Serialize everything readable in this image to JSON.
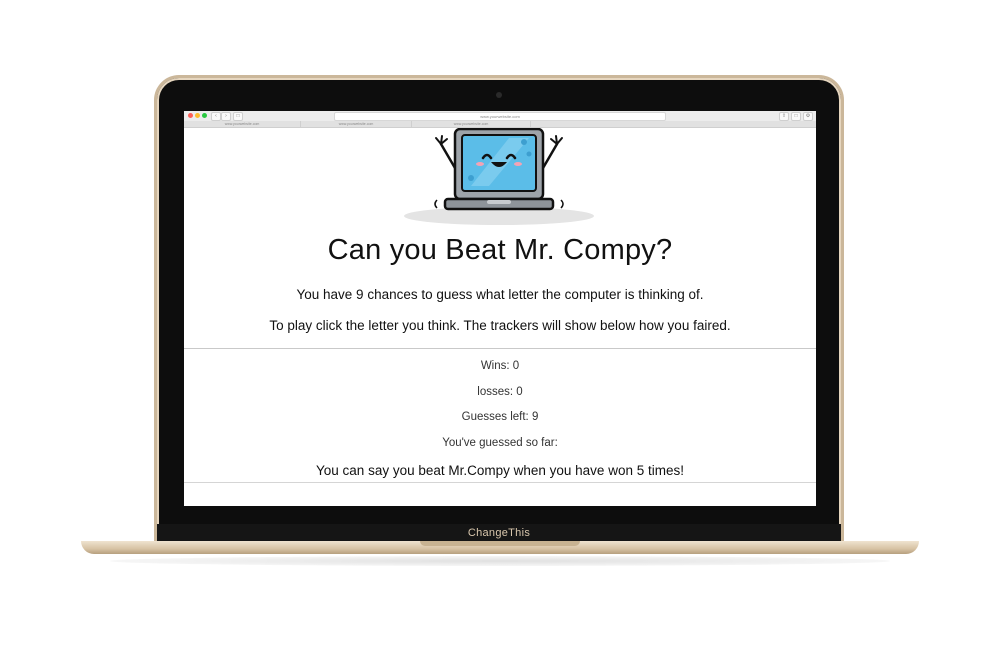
{
  "browser": {
    "address": "www.yourwebsite.com",
    "tabs": [
      "www.yourwebsite.com",
      "www.yourwebsite.com",
      "www.yourwebsite.com"
    ]
  },
  "page": {
    "title": "Can you Beat Mr. Compy?",
    "intro_1": "You have 9 chances to guess what letter the computer is thinking of.",
    "intro_2": "To play click the letter you think. The trackers will show below how you faired.",
    "wins": "Wins: 0",
    "losses": "losses: 0",
    "guesses_left": "Guesses left: 9",
    "guessed_so_far": "You've guessed so far:",
    "goal": "You can say you beat Mr.Compy when you have won 5 times!"
  },
  "device": {
    "brand": "ChangeThis"
  },
  "colors": {
    "screen_blue": "#5bbde8",
    "laptop_gold": "#d9c7ad",
    "bezel": "#0d0d0d"
  }
}
